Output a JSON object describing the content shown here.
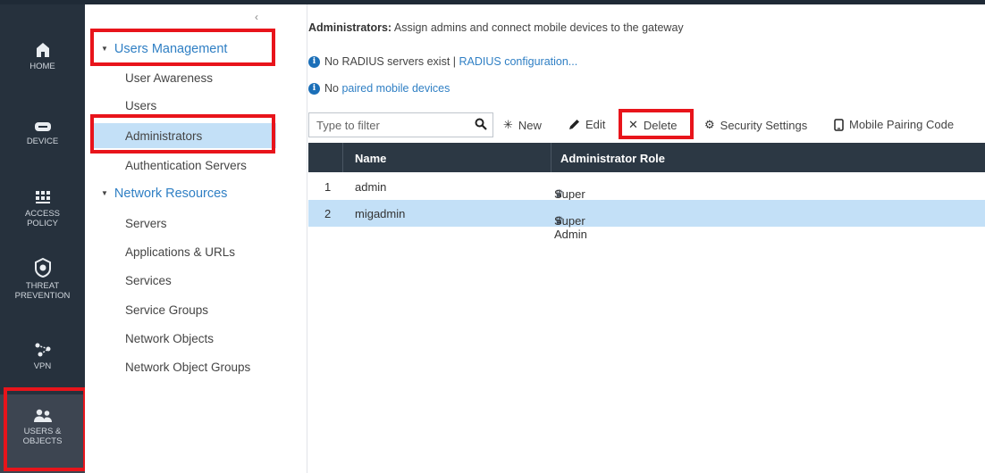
{
  "rail": {
    "items": [
      {
        "label": "HOME",
        "icon": "home-icon"
      },
      {
        "label": "DEVICE",
        "icon": "device-icon"
      },
      {
        "label_line1": "ACCESS",
        "label_line2": "POLICY",
        "icon": "access-policy-icon"
      },
      {
        "label_line1": "THREAT",
        "label_line2": "PREVENTION",
        "icon": "threat-prevention-icon"
      },
      {
        "label": "VPN",
        "icon": "vpn-icon"
      },
      {
        "label_line1": "USERS &",
        "label_line2": "OBJECTS",
        "icon": "users-objects-icon"
      }
    ]
  },
  "sidebar": {
    "users_management": {
      "title": "Users Management",
      "items": [
        "User Awareness",
        "Users",
        "Administrators",
        "Authentication Servers"
      ]
    },
    "network_resources": {
      "title": "Network Resources",
      "items": [
        "Servers",
        "Applications & URLs",
        "Services",
        "Service Groups",
        "Network Objects",
        "Network Object Groups"
      ]
    },
    "collapse_glyph": "‹"
  },
  "main": {
    "title_bold": "Administrators:",
    "title_rest": " Assign admins and connect mobile devices to the gateway",
    "radius_text": "No RADIUS servers exist | ",
    "radius_link": "RADIUS configuration...",
    "mobile_prefix": "No ",
    "mobile_link": "paired mobile devices"
  },
  "toolbar": {
    "filter_placeholder": "Type to filter",
    "new_label": "New",
    "edit_label": "Edit",
    "delete_label": "Delete",
    "security_label": "Security Settings",
    "pairing_label": "Mobile Pairing Code"
  },
  "table": {
    "headers": [
      "Name",
      "Administrator Role"
    ],
    "rows": [
      {
        "num": "1",
        "name": "admin",
        "role": "Super Admin"
      },
      {
        "num": "2",
        "name": "migadmin",
        "role": "Super Admin"
      }
    ],
    "selected_row": 2
  },
  "colors": {
    "highlight_box": "#e8141b",
    "selection": "#c3e0f7",
    "link": "#2f7fc4",
    "header_bg": "#2c3844"
  }
}
